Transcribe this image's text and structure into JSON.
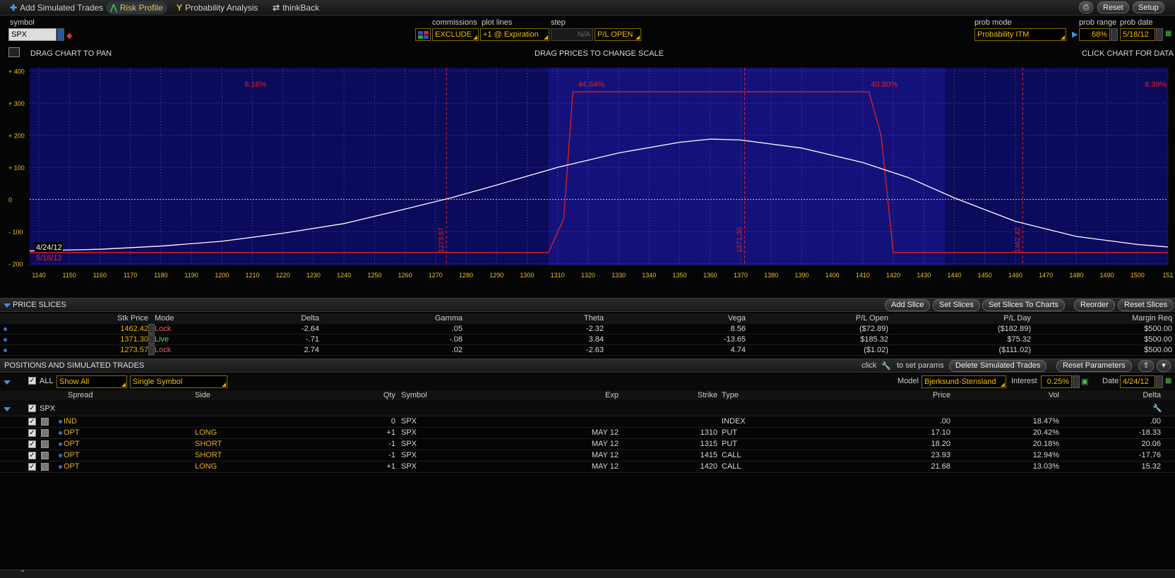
{
  "topbar": {
    "add_trades": "Add Simulated Trades",
    "risk_profile": "Risk Profile",
    "probability": "Probability Analysis",
    "thinkback": "thinkBack",
    "reset": "Reset",
    "setup": "Setup"
  },
  "controls": {
    "symbol_label": "symbol",
    "symbol_value": "SPX",
    "commissions_label": "commissions",
    "commissions_value": "EXCLUDE",
    "plotlines_label": "plot lines",
    "plotlines_value": "+1 @ Expiration",
    "step_label": "step",
    "step_value": "N/A",
    "pl_value": "P/L OPEN",
    "probmode_label": "prob mode",
    "probmode_value": "Probability ITM",
    "probrange_label": "prob range",
    "probrange_value": "68%",
    "probdate_label": "prob date",
    "probdate_value": "5/18/12"
  },
  "hints": {
    "pan": "DRAG CHART TO PAN",
    "scale": "DRAG PRICES TO CHANGE SCALE",
    "click": "CLICK CHART FOR DATA"
  },
  "colors": {
    "plot_bg": "#14127a",
    "plot_band": "#0c0a5a",
    "expiry_line": "#e02020",
    "today_line": "#ffffff",
    "axis_text": "#e8c020"
  },
  "chart_data": {
    "type": "line",
    "x_ticks": [
      "1140",
      "1150",
      "1160",
      "1170",
      "1180",
      "1190",
      "1200",
      "1210",
      "1220",
      "1230",
      "1240",
      "1250",
      "1260",
      "1270",
      "1280",
      "1290",
      "1300",
      "1310",
      "1320",
      "1330",
      "1340",
      "1350",
      "1360",
      "1370",
      "1380",
      "1390",
      "1400",
      "1410",
      "1420",
      "1430",
      "1440",
      "1450",
      "1460",
      "1470",
      "1480",
      "1490",
      "1500",
      "151"
    ],
    "y_ticks": [
      "+ 400",
      "+ 300",
      "+ 200",
      "+ 100",
      "0",
      "- 100",
      "- 200"
    ],
    "xlim": [
      1137,
      1510
    ],
    "ylim": [
      -205,
      410
    ],
    "probabilities": [
      {
        "label": "8.16%",
        "x": 1211
      },
      {
        "label": "44.64%",
        "x": 1321
      },
      {
        "label": "40.80%",
        "x": 1417
      },
      {
        "label": "8.39%",
        "x": 1506
      }
    ],
    "slice_lines": [
      {
        "label": "1273.57",
        "x": 1273.57
      },
      {
        "label": "1371.30",
        "x": 1371.3
      },
      {
        "label": "1462.42",
        "x": 1462.42
      }
    ],
    "date_labels": {
      "today": "4/24/12",
      "expiry": "5/18/12"
    },
    "series": [
      {
        "name": "5/18/12",
        "points": [
          [
            1137,
            -165
          ],
          [
            1307,
            -165
          ],
          [
            1312,
            -60
          ],
          [
            1315,
            335
          ],
          [
            1412,
            335
          ],
          [
            1416,
            200
          ],
          [
            1420,
            -165
          ],
          [
            1510,
            -165
          ]
        ]
      },
      {
        "name": "4/24/12",
        "points": [
          [
            1137,
            -160
          ],
          [
            1160,
            -155
          ],
          [
            1180,
            -145
          ],
          [
            1200,
            -130
          ],
          [
            1220,
            -105
          ],
          [
            1240,
            -75
          ],
          [
            1260,
            -30
          ],
          [
            1275,
            5
          ],
          [
            1290,
            45
          ],
          [
            1310,
            100
          ],
          [
            1330,
            145
          ],
          [
            1350,
            178
          ],
          [
            1360,
            188
          ],
          [
            1370,
            185
          ],
          [
            1390,
            160
          ],
          [
            1410,
            115
          ],
          [
            1425,
            68
          ],
          [
            1440,
            5
          ],
          [
            1460,
            -68
          ],
          [
            1480,
            -115
          ],
          [
            1500,
            -140
          ],
          [
            1510,
            -148
          ]
        ]
      }
    ]
  },
  "price_slices": {
    "title": "PRICE SLICES",
    "buttons": [
      "Add Slice",
      "Set Slices",
      "Set Slices To Charts",
      "Reorder",
      "Reset Slices"
    ],
    "headers": {
      "stk": "Stk Price",
      "mode": "Mode",
      "delta": "Delta",
      "gamma": "Gamma",
      "theta": "Theta",
      "vega": "Vega",
      "plopen": "P/L Open",
      "plday": "P/L Day",
      "margin": "Margin Req"
    },
    "rows": [
      {
        "stk": "1462.42",
        "mode": "Lock",
        "delta": "-2.64",
        "gamma": ".05",
        "theta": "-2.32",
        "vega": "8.56",
        "plopen": "($72.89)",
        "plday": "($182.89)",
        "margin": "$500.00"
      },
      {
        "stk": "1371.30",
        "mode": "Live",
        "delta": "-.71",
        "gamma": "-.08",
        "theta": "3.84",
        "vega": "-13.65",
        "plopen": "$185.32",
        "plday": "$75.32",
        "margin": "$500.00"
      },
      {
        "stk": "1273.57",
        "mode": "Lock",
        "delta": "2.74",
        "gamma": ".02",
        "theta": "-2.63",
        "vega": "4.74",
        "plopen": "($1.02)",
        "plday": "($111.02)",
        "margin": "$500.00"
      }
    ]
  },
  "positions": {
    "title": "POSITIONS AND SIMULATED TRADES",
    "click": "click",
    "to_set": "to set params",
    "delete_btn": "Delete Simulated Trades",
    "reset_btn": "Reset Parameters",
    "all": "ALL",
    "show": "Show All",
    "mode": "Single Symbol",
    "model_label": "Model",
    "model_value": "Bjerksund-Stensland",
    "interest_label": "Interest",
    "interest_value": "0.25%",
    "date_label": "Date",
    "date_value": "4/24/12",
    "headers": {
      "spread": "Spread",
      "side": "Side",
      "qty": "Qty",
      "symbol": "Symbol",
      "exp": "Exp",
      "strike": "Strike",
      "type": "Type",
      "price": "Price",
      "vol": "Vol",
      "delta": "Delta"
    },
    "group": "SPX",
    "rows": [
      {
        "spread": "IND",
        "side": "",
        "qty": "0",
        "symbol": "SPX",
        "exp": "",
        "strike": "",
        "type": "INDEX",
        "price": ".00",
        "vol": "18.47%",
        "delta": ".00"
      },
      {
        "spread": "OPT",
        "side": "LONG",
        "qty": "+1",
        "symbol": "SPX",
        "exp": "MAY 12",
        "strike": "1310",
        "type": "PUT",
        "price": "17.10",
        "vol": "20.42%",
        "delta": "-18.33"
      },
      {
        "spread": "OPT",
        "side": "SHORT",
        "qty": "-1",
        "symbol": "SPX",
        "exp": "MAY 12",
        "strike": "1315",
        "type": "PUT",
        "price": "18.20",
        "vol": "20.18%",
        "delta": "20.06"
      },
      {
        "spread": "OPT",
        "side": "SHORT",
        "qty": "-1",
        "symbol": "SPX",
        "exp": "MAY 12",
        "strike": "1415",
        "type": "CALL",
        "price": "23.93",
        "vol": "12.94%",
        "delta": "-17.76"
      },
      {
        "spread": "OPT",
        "side": "LONG",
        "qty": "+1",
        "symbol": "SPX",
        "exp": "MAY 12",
        "strike": "1420",
        "type": "CALL",
        "price": "21.68",
        "vol": "13.03%",
        "delta": "15.32"
      }
    ]
  }
}
